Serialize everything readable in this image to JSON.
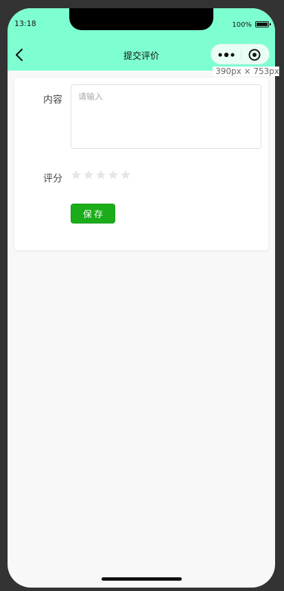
{
  "status_bar": {
    "time": "13:18",
    "battery": "100%"
  },
  "nav": {
    "title": "提交评价"
  },
  "size_label": "390px × 753px",
  "form": {
    "content_label": "内容",
    "content_placeholder": "请输入",
    "content_value": "",
    "rating_label": "评分",
    "rating_value": 0,
    "rating_max": 5,
    "star_empty_color": "#e4e6e9",
    "save_label": "保存"
  },
  "colors": {
    "nav_background": "#7effd0",
    "save_button": "#1aad19",
    "page_background": "#f8f8f8"
  }
}
